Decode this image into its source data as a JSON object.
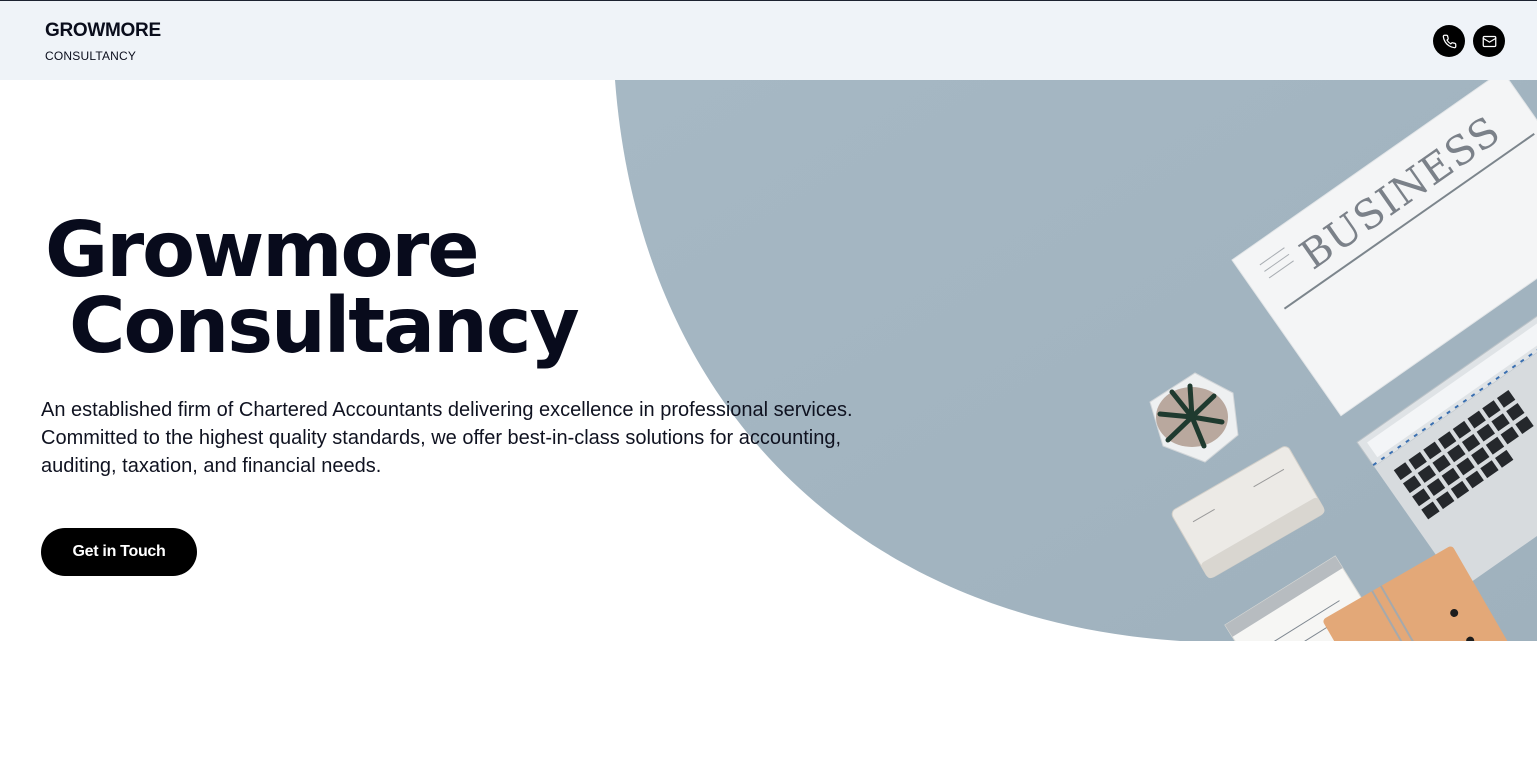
{
  "header": {
    "brand_name": "GROWMORE",
    "brand_subtitle": "CONSULTANCY",
    "phone_icon": "phone-icon",
    "mail_icon": "mail-icon"
  },
  "hero": {
    "title_line1": "Growmore",
    "title_line2": "Consultancy",
    "description": "An established firm of Chartered Accountants delivering excellence in professional services. Committed to the highest quality standards, we offer best-in-class solutions for accounting, auditing, taxation, and financial needs.",
    "cta_label": "Get in Touch",
    "image_newspaper_text": "BUSINESS"
  },
  "colors": {
    "header_bg": "#eff3f8",
    "hero_shape": "#a3b5c1",
    "button_bg": "#000000",
    "text": "#0a0d1c"
  }
}
